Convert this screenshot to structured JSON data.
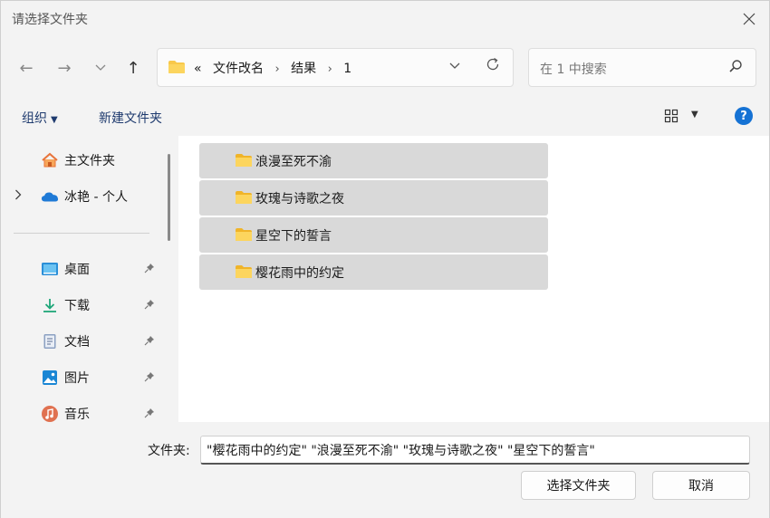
{
  "window": {
    "title": "请选择文件夹"
  },
  "nav": {
    "back": "←",
    "forward": "→",
    "recent": "⌄",
    "up": "↑",
    "breadcrumb_overflow": "«",
    "breadcrumbs": [
      "文件改名",
      "结果",
      "1"
    ],
    "separator": "›",
    "search_placeholder": "在 1 中搜索"
  },
  "toolbar": {
    "organize_label": "组织",
    "new_folder_label": "新建文件夹"
  },
  "sidebar": {
    "items": [
      {
        "label": "主文件夹",
        "icon": "home-icon"
      },
      {
        "label": "冰艳 - 个人",
        "icon": "onedrive-icon"
      },
      {
        "label": "桌面",
        "icon": "desktop-icon"
      },
      {
        "label": "下载",
        "icon": "download-icon"
      },
      {
        "label": "文档",
        "icon": "document-icon"
      },
      {
        "label": "图片",
        "icon": "pictures-icon"
      },
      {
        "label": "音乐",
        "icon": "music-icon"
      }
    ]
  },
  "folders": [
    {
      "name": "浪漫至死不渝"
    },
    {
      "name": "玫瑰与诗歌之夜"
    },
    {
      "name": "星空下的誓言"
    },
    {
      "name": "樱花雨中的约定"
    }
  ],
  "bottom": {
    "folder_label": "文件夹:",
    "folder_value": "\"樱花雨中的约定\" \"浪漫至死不渝\" \"玫瑰与诗歌之夜\" \"星空下的誓言\"",
    "select_button": "选择文件夹",
    "cancel_button": "取消"
  },
  "colors": {
    "accent": "#1572d4",
    "folder_yellow": "#f8c84a",
    "selection": "#d9d9d9"
  }
}
